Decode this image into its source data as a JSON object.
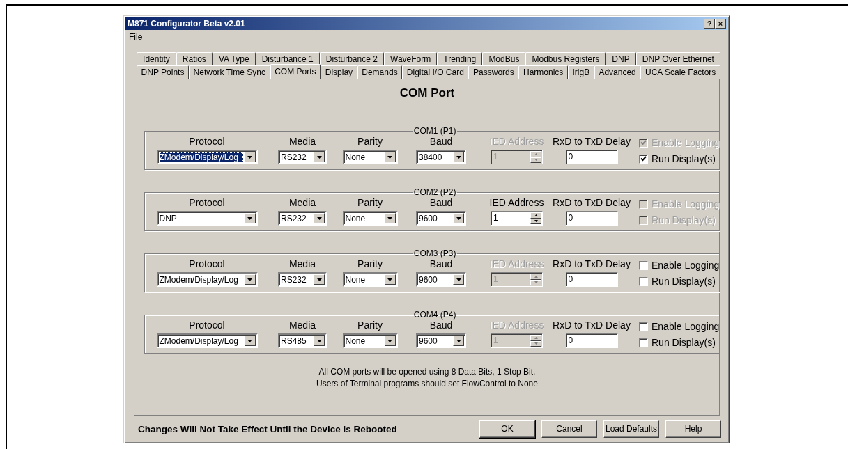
{
  "window": {
    "title": "M871 Configurator Beta v2.01",
    "buttons": [
      "?",
      "×"
    ]
  },
  "menu": [
    "File"
  ],
  "tab_rows": [
    [
      {
        "label": "Identity",
        "selected": false
      },
      {
        "label": "Ratios",
        "selected": false
      },
      {
        "label": "VA Type",
        "selected": false
      },
      {
        "label": "Disturbance 1",
        "selected": false
      },
      {
        "label": "Disturbance 2",
        "selected": false
      },
      {
        "label": "WaveForm",
        "selected": false
      },
      {
        "label": "Trending",
        "selected": false
      },
      {
        "label": "ModBus",
        "selected": false
      },
      {
        "label": "Modbus Registers",
        "selected": false
      },
      {
        "label": "DNP",
        "selected": false
      },
      {
        "label": "DNP Over Ethernet",
        "selected": false
      }
    ],
    [
      {
        "label": "DNP Points",
        "selected": false
      },
      {
        "label": "Network Time Sync",
        "selected": false
      },
      {
        "label": "COM Ports",
        "selected": true
      },
      {
        "label": "Display",
        "selected": false
      },
      {
        "label": "Demands",
        "selected": false
      },
      {
        "label": "Digital I/O Card",
        "selected": false
      },
      {
        "label": "Passwords",
        "selected": false
      },
      {
        "label": "Harmonics",
        "selected": false
      },
      {
        "label": "IrigB",
        "selected": false
      },
      {
        "label": "Advanced",
        "selected": false
      },
      {
        "label": "UCA Scale Factors",
        "selected": false
      }
    ]
  ],
  "heading": "COM Port",
  "ports": [
    {
      "title": "COM1 (P1)",
      "protocol": {
        "label": "Protocol",
        "value": "ZModem/Display/Log",
        "highlighted": true
      },
      "media": {
        "label": "Media",
        "value": "RS232"
      },
      "parity": {
        "label": "Parity",
        "value": "None"
      },
      "baud": {
        "label": "Baud",
        "value": "38400"
      },
      "ied_address": {
        "label": "IED Address",
        "value": "1",
        "disabled": true
      },
      "delay": {
        "label": "RxD to TxD Delay",
        "value": "0"
      },
      "enable_logging": {
        "label": "Enable Logging",
        "checked": true,
        "disabled": true
      },
      "run_display": {
        "label": "Run Display(s)",
        "checked": true,
        "disabled": false
      }
    },
    {
      "title": "COM2 (P2)",
      "protocol": {
        "label": "Protocol",
        "value": "DNP",
        "highlighted": false
      },
      "media": {
        "label": "Media",
        "value": "RS232"
      },
      "parity": {
        "label": "Parity",
        "value": "None"
      },
      "baud": {
        "label": "Baud",
        "value": "9600"
      },
      "ied_address": {
        "label": "IED Address",
        "value": "1",
        "disabled": false
      },
      "delay": {
        "label": "RxD to TxD Delay",
        "value": "0"
      },
      "enable_logging": {
        "label": "Enable Logging",
        "checked": false,
        "disabled": true
      },
      "run_display": {
        "label": "Run Display(s)",
        "checked": false,
        "disabled": true
      }
    },
    {
      "title": "COM3 (P3)",
      "protocol": {
        "label": "Protocol",
        "value": "ZModem/Display/Log",
        "highlighted": false
      },
      "media": {
        "label": "Media",
        "value": "RS232"
      },
      "parity": {
        "label": "Parity",
        "value": "None"
      },
      "baud": {
        "label": "Baud",
        "value": "9600"
      },
      "ied_address": {
        "label": "IED Address",
        "value": "1",
        "disabled": true
      },
      "delay": {
        "label": "RxD to TxD Delay",
        "value": "0"
      },
      "enable_logging": {
        "label": "Enable Logging",
        "checked": false,
        "disabled": false
      },
      "run_display": {
        "label": "Run Display(s)",
        "checked": false,
        "disabled": false
      }
    },
    {
      "title": "COM4 (P4)",
      "protocol": {
        "label": "Protocol",
        "value": "ZModem/Display/Log",
        "highlighted": false
      },
      "media": {
        "label": "Media",
        "value": "RS485"
      },
      "parity": {
        "label": "Parity",
        "value": "None"
      },
      "baud": {
        "label": "Baud",
        "value": "9600"
      },
      "ied_address": {
        "label": "IED Address",
        "value": "1",
        "disabled": true
      },
      "delay": {
        "label": "RxD to TxD Delay",
        "value": "0"
      },
      "enable_logging": {
        "label": "Enable Logging",
        "checked": false,
        "disabled": false
      },
      "run_display": {
        "label": "Run Display(s)",
        "checked": false,
        "disabled": false
      }
    }
  ],
  "notes": [
    "All COM ports will be opened using 8 Data Bits, 1 Stop Bit.",
    "Users of Terminal programs should set FlowControl to None"
  ],
  "footer": {
    "message": "Changes Will Not Take Effect Until the Device is Rebooted",
    "buttons": [
      "OK",
      "Cancel",
      "Load Defaults",
      "Help"
    ]
  }
}
